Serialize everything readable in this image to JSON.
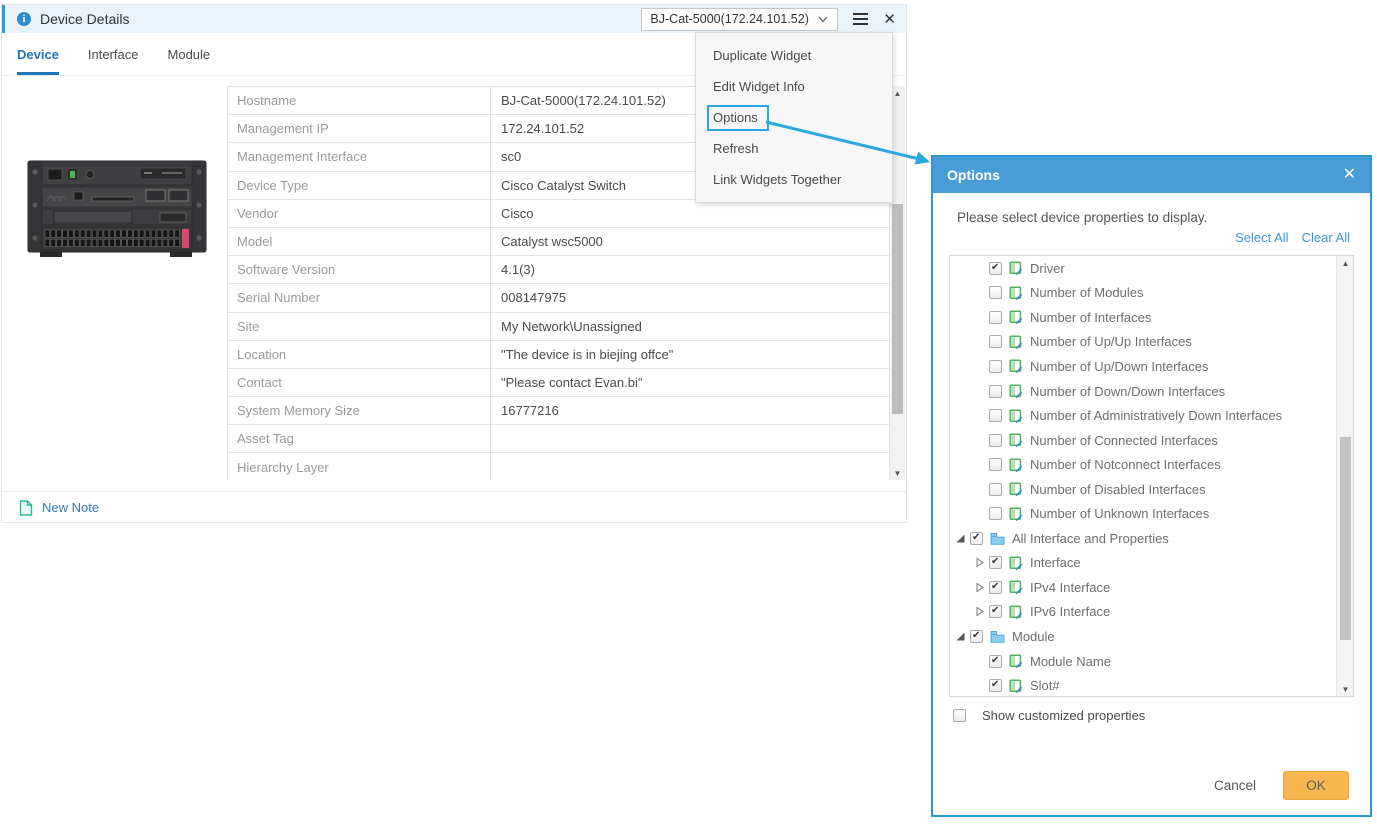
{
  "colors": {
    "accent_blue": "#2e9ad6",
    "dialog_header_blue": "#4a9cd8",
    "highlight_border_blue": "#29a8e0",
    "link_blue": "#3c97d8",
    "active_tab_blue": "#1f74b8",
    "ok_button_orange": "#f7b64e",
    "header_bg_light_blue": "#e9f3fb"
  },
  "widget": {
    "title": "Device Details",
    "device_selector": {
      "value": "BJ-Cat-5000(172.24.101.52)"
    },
    "tabs": [
      {
        "label": "Device",
        "active": true
      },
      {
        "label": "Interface",
        "active": false
      },
      {
        "label": "Module",
        "active": false
      }
    ],
    "properties": [
      {
        "label": "Hostname",
        "value": "BJ-Cat-5000(172.24.101.52)"
      },
      {
        "label": "Management IP",
        "value": "172.24.101.52"
      },
      {
        "label": "Management Interface",
        "value": "sc0"
      },
      {
        "label": "Device Type",
        "value": "Cisco Catalyst Switch"
      },
      {
        "label": "Vendor",
        "value": "Cisco"
      },
      {
        "label": "Model",
        "value": "Catalyst wsc5000"
      },
      {
        "label": "Software Version",
        "value": "4.1(3)"
      },
      {
        "label": "Serial Number",
        "value": "008147975"
      },
      {
        "label": "Site",
        "value": "My Network\\Unassigned"
      },
      {
        "label": "Location",
        "value": "\"The device is in biejing offce\""
      },
      {
        "label": "Contact",
        "value": "\"Please contact Evan.bi\""
      },
      {
        "label": "System Memory Size",
        "value": "16777216"
      },
      {
        "label": "Asset Tag",
        "value": ""
      },
      {
        "label": "Hierarchy Layer",
        "value": ""
      }
    ],
    "footer": {
      "new_note_label": "New Note"
    }
  },
  "menu": {
    "items": [
      "Duplicate Widget",
      "Edit Widget Info",
      "Options",
      "Refresh",
      "Link Widgets Together"
    ],
    "highlighted": "Options"
  },
  "dialog": {
    "title": "Options",
    "description": "Please select device properties to display.",
    "select_all_label": "Select All",
    "clear_all_label": "Clear All",
    "tree": [
      {
        "label": "Driver",
        "level": 1,
        "checked": true,
        "icon": "property"
      },
      {
        "label": "Number of Modules",
        "level": 1,
        "checked": false,
        "icon": "property"
      },
      {
        "label": "Number of Interfaces",
        "level": 1,
        "checked": false,
        "icon": "property"
      },
      {
        "label": "Number of Up/Up Interfaces",
        "level": 1,
        "checked": false,
        "icon": "property"
      },
      {
        "label": "Number of Up/Down Interfaces",
        "level": 1,
        "checked": false,
        "icon": "property"
      },
      {
        "label": "Number of Down/Down Interfaces",
        "level": 1,
        "checked": false,
        "icon": "property"
      },
      {
        "label": "Number of Administratively Down Interfaces",
        "level": 1,
        "checked": false,
        "icon": "property"
      },
      {
        "label": "Number of Connected Interfaces",
        "level": 1,
        "checked": false,
        "icon": "property"
      },
      {
        "label": "Number of Notconnect Interfaces",
        "level": 1,
        "checked": false,
        "icon": "property"
      },
      {
        "label": "Number of Disabled Interfaces",
        "level": 1,
        "checked": false,
        "icon": "property"
      },
      {
        "label": "Number of Unknown Interfaces",
        "level": 1,
        "checked": false,
        "icon": "property"
      },
      {
        "label": "All Interface and Properties",
        "level": 0,
        "checked": true,
        "icon": "folder",
        "expand": "expanded"
      },
      {
        "label": "Interface",
        "level": 1,
        "checked": true,
        "icon": "property",
        "expand": "collapsed"
      },
      {
        "label": "IPv4 Interface",
        "level": 1,
        "checked": true,
        "icon": "property",
        "expand": "collapsed"
      },
      {
        "label": "IPv6 Interface",
        "level": 1,
        "checked": true,
        "icon": "property",
        "expand": "collapsed"
      },
      {
        "label": "Module",
        "level": 0,
        "checked": true,
        "icon": "folder",
        "expand": "expanded"
      },
      {
        "label": "Module Name",
        "level": 1,
        "checked": true,
        "icon": "property"
      },
      {
        "label": "Slot#",
        "level": 1,
        "checked": true,
        "icon": "property"
      }
    ],
    "show_customized_label": "Show customized properties",
    "cancel_label": "Cancel",
    "ok_label": "OK"
  }
}
